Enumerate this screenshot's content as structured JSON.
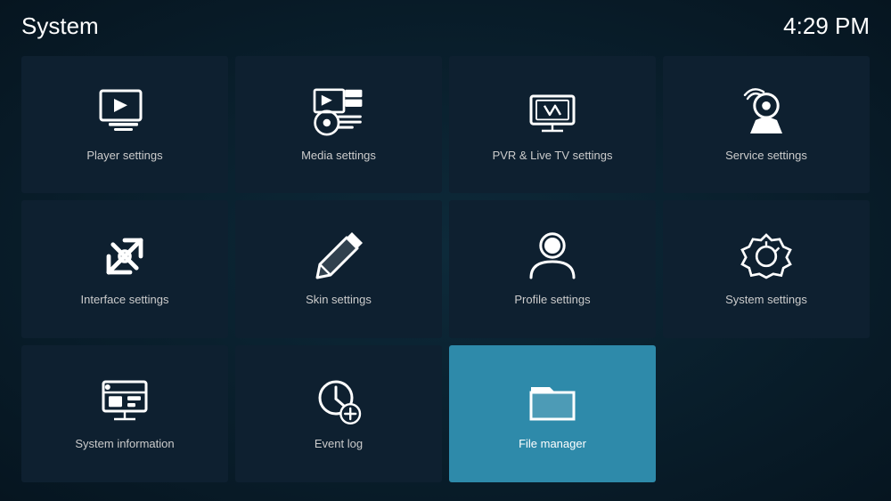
{
  "header": {
    "title": "System",
    "time": "4:29 PM"
  },
  "tiles": [
    {
      "id": "player-settings",
      "label": "Player settings",
      "icon": "player",
      "active": false
    },
    {
      "id": "media-settings",
      "label": "Media settings",
      "icon": "media",
      "active": false
    },
    {
      "id": "pvr-settings",
      "label": "PVR & Live TV settings",
      "icon": "pvr",
      "active": false
    },
    {
      "id": "service-settings",
      "label": "Service settings",
      "icon": "service",
      "active": false
    },
    {
      "id": "interface-settings",
      "label": "Interface settings",
      "icon": "interface",
      "active": false
    },
    {
      "id": "skin-settings",
      "label": "Skin settings",
      "icon": "skin",
      "active": false
    },
    {
      "id": "profile-settings",
      "label": "Profile settings",
      "icon": "profile",
      "active": false
    },
    {
      "id": "system-settings",
      "label": "System settings",
      "icon": "system",
      "active": false
    },
    {
      "id": "system-information",
      "label": "System information",
      "icon": "sysinfo",
      "active": false
    },
    {
      "id": "event-log",
      "label": "Event log",
      "icon": "eventlog",
      "active": false
    },
    {
      "id": "file-manager",
      "label": "File manager",
      "icon": "filemanager",
      "active": true
    }
  ]
}
